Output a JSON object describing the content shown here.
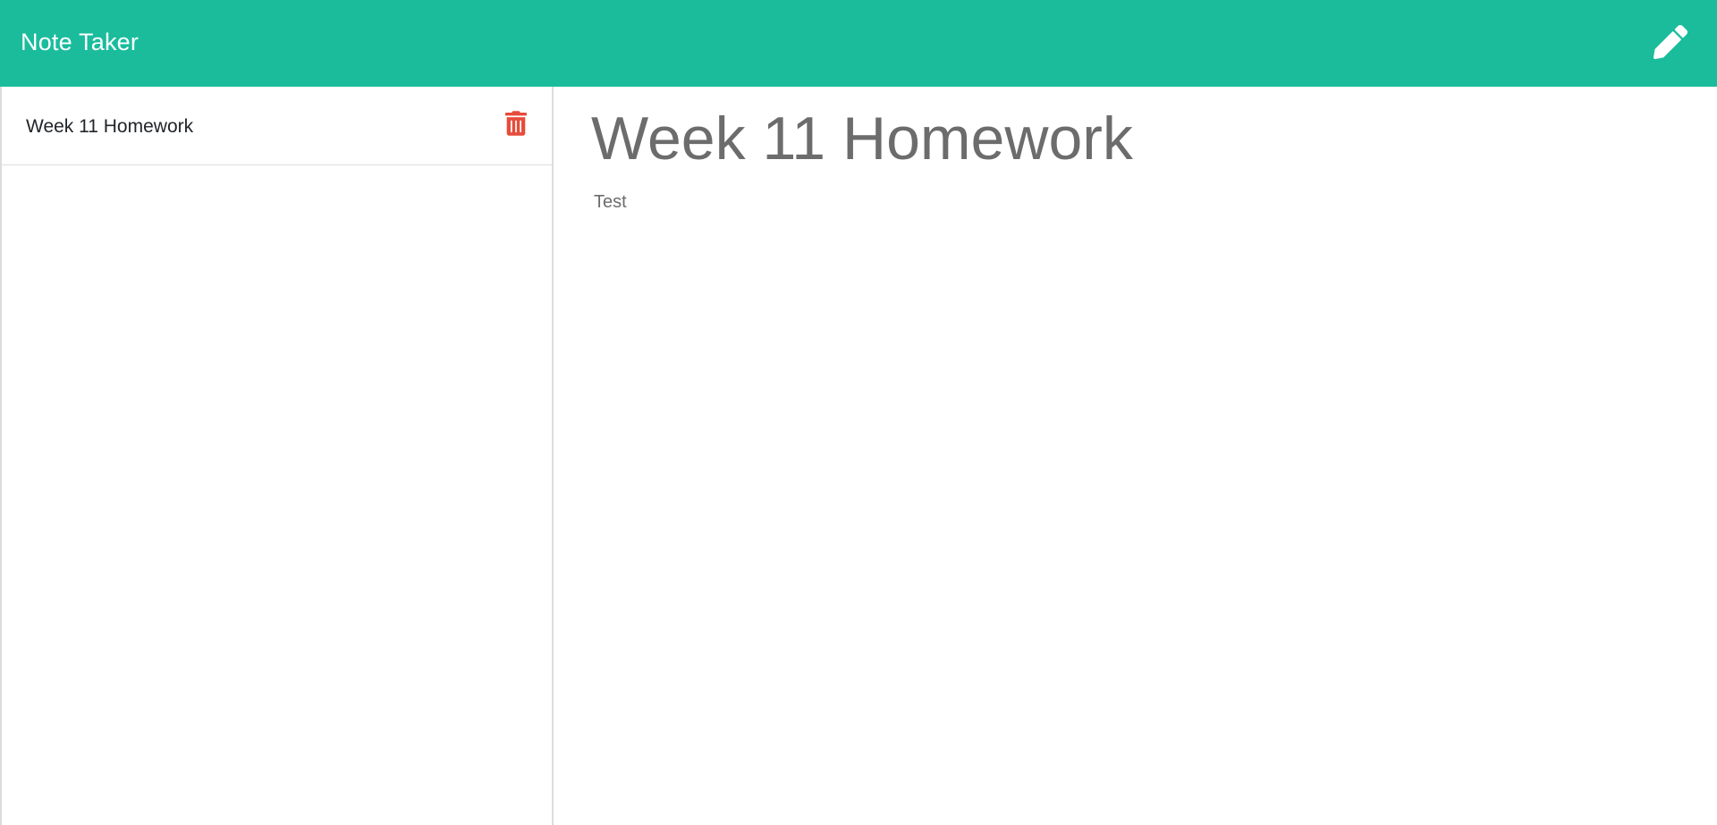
{
  "app": {
    "title": "Note Taker",
    "accent_color": "#1abc9c",
    "new_note_icon": "pencil-icon"
  },
  "sidebar": {
    "notes": [
      {
        "title": "Week 11 Homework",
        "delete_icon": "trash-icon",
        "delete_color": "#e74c3c"
      }
    ]
  },
  "editor": {
    "title": "Week 11 Homework",
    "body": "Test"
  }
}
